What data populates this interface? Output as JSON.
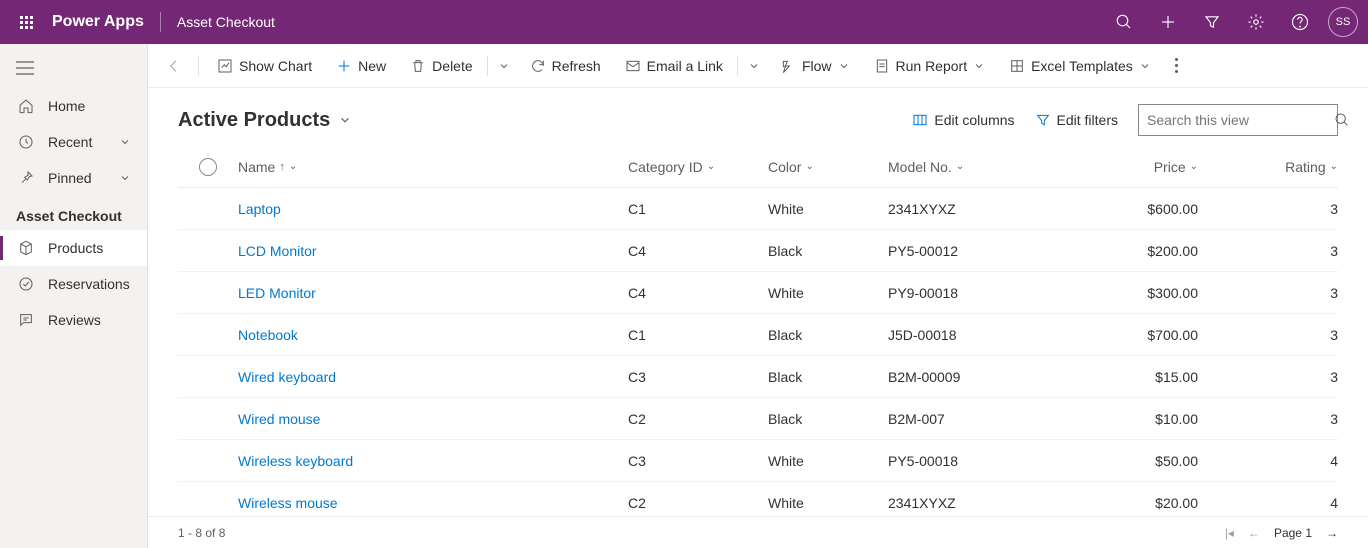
{
  "header": {
    "app_name": "Power Apps",
    "module_name": "Asset Checkout",
    "avatar_initials": "SS"
  },
  "sidebar": {
    "home": "Home",
    "recent": "Recent",
    "pinned": "Pinned",
    "section_title": "Asset Checkout",
    "items": [
      {
        "label": "Products"
      },
      {
        "label": "Reservations"
      },
      {
        "label": "Reviews"
      }
    ]
  },
  "commands": {
    "show_chart": "Show Chart",
    "new": "New",
    "delete": "Delete",
    "refresh": "Refresh",
    "email_link": "Email a Link",
    "flow": "Flow",
    "run_report": "Run Report",
    "excel_templates": "Excel Templates"
  },
  "view": {
    "title": "Active Products",
    "edit_columns": "Edit columns",
    "edit_filters": "Edit filters",
    "search_placeholder": "Search this view"
  },
  "columns": {
    "name": "Name",
    "category": "Category ID",
    "color": "Color",
    "model": "Model No.",
    "price": "Price",
    "rating": "Rating"
  },
  "rows": [
    {
      "name": "Laptop",
      "category": "C1",
      "color": "White",
      "model": "2341XYXZ",
      "price": "$600.00",
      "rating": "3"
    },
    {
      "name": "LCD Monitor",
      "category": "C4",
      "color": "Black",
      "model": "PY5-00012",
      "price": "$200.00",
      "rating": "3"
    },
    {
      "name": "LED Monitor",
      "category": "C4",
      "color": "White",
      "model": "PY9-00018",
      "price": "$300.00",
      "rating": "3"
    },
    {
      "name": "Notebook",
      "category": "C1",
      "color": "Black",
      "model": "J5D-00018",
      "price": "$700.00",
      "rating": "3"
    },
    {
      "name": "Wired keyboard",
      "category": "C3",
      "color": "Black",
      "model": "B2M-00009",
      "price": "$15.00",
      "rating": "3"
    },
    {
      "name": "Wired mouse",
      "category": "C2",
      "color": "Black",
      "model": "B2M-007",
      "price": "$10.00",
      "rating": "3"
    },
    {
      "name": "Wireless keyboard",
      "category": "C3",
      "color": "White",
      "model": "PY5-00018",
      "price": "$50.00",
      "rating": "4"
    },
    {
      "name": "Wireless mouse",
      "category": "C2",
      "color": "White",
      "model": "2341XYXZ",
      "price": "$20.00",
      "rating": "4"
    }
  ],
  "footer": {
    "record_count": "1 - 8 of 8",
    "page_label": "Page 1"
  }
}
